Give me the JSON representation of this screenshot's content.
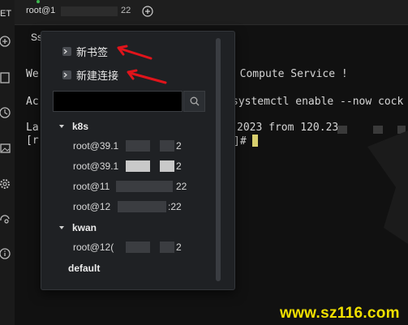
{
  "tabbar": {
    "tab_prefix": "root@1",
    "tab_suffix": "22",
    "add_tab_icon": "plus-circle-icon"
  },
  "terminal": {
    "sub_tab": "Ss",
    "lines": [
      "We",
      "Ac",
      "La",
      "[r"
    ],
    "line_right_1": "c Compute Service !",
    "line_right_2": "systemctl enable --now cock",
    "line_right_3": "2023 from 120.23",
    "line_right_4": "]# "
  },
  "menu": {
    "new_bookmark": "新书签",
    "new_connection": "新建连接",
    "search_value": "",
    "search_icon": "search-icon"
  },
  "groups": [
    {
      "name": "k8s",
      "items": [
        {
          "prefix": "root@39.1",
          "suffix": "2"
        },
        {
          "prefix": "root@39.1",
          "suffix": "2"
        },
        {
          "prefix": "root@11",
          "suffix": "22"
        },
        {
          "prefix": "root@12",
          "suffix": ":22"
        }
      ]
    },
    {
      "name": "kwan",
      "items": [
        {
          "prefix": "root@12(",
          "suffix": "2"
        }
      ]
    },
    {
      "name": "default",
      "items": []
    }
  ],
  "watermark": "www.sz116.com",
  "colors": {
    "accent_arrow": "#e0141b",
    "watermark": "#f0e000",
    "cursor": "#d8cf6e",
    "status_dot": "#3fb950"
  }
}
